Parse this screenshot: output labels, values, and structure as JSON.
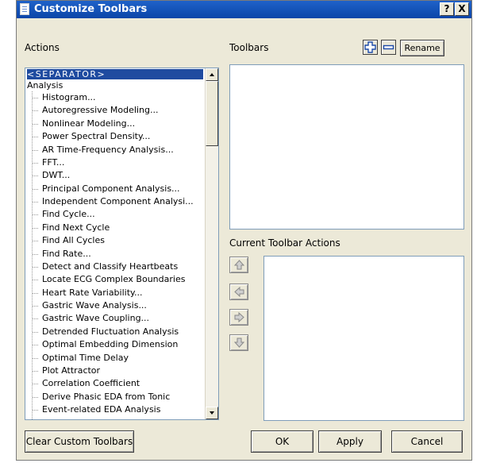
{
  "window": {
    "title": "Customize Toolbars",
    "help_glyph": "?",
    "close_glyph": "X"
  },
  "actions": {
    "label": "Actions",
    "separator": "<SEPARATOR>",
    "group": "Analysis",
    "items": [
      "Histogram...",
      "Autoregressive Modeling...",
      "Nonlinear Modeling...",
      "Power Spectral Density...",
      "AR Time-Frequency Analysis...",
      "FFT...",
      "DWT...",
      "Principal Component Analysis...",
      "Independent Component Analysi...",
      "Find Cycle...",
      "Find Next Cycle",
      "Find All Cycles",
      "Find Rate...",
      "Detect and Classify Heartbeats",
      "Locate ECG Complex Boundaries",
      "Heart Rate Variability...",
      "Gastric Wave Analysis...",
      "Gastric Wave Coupling...",
      "Detrended Fluctuation Analysis",
      "Optimal Embedding Dimension",
      "Optimal Time Delay",
      "Plot Attractor",
      "Correlation Coefficient",
      "Derive Phasic EDA from Tonic",
      "Event-related EDA Analysis"
    ]
  },
  "toolbars": {
    "label": "Toolbars",
    "rename_label": "Rename"
  },
  "current_actions": {
    "label": "Current Toolbar Actions"
  },
  "buttons": {
    "clear": "Clear Custom Toolbars",
    "ok": "OK",
    "apply": "Apply",
    "cancel": "Cancel"
  }
}
